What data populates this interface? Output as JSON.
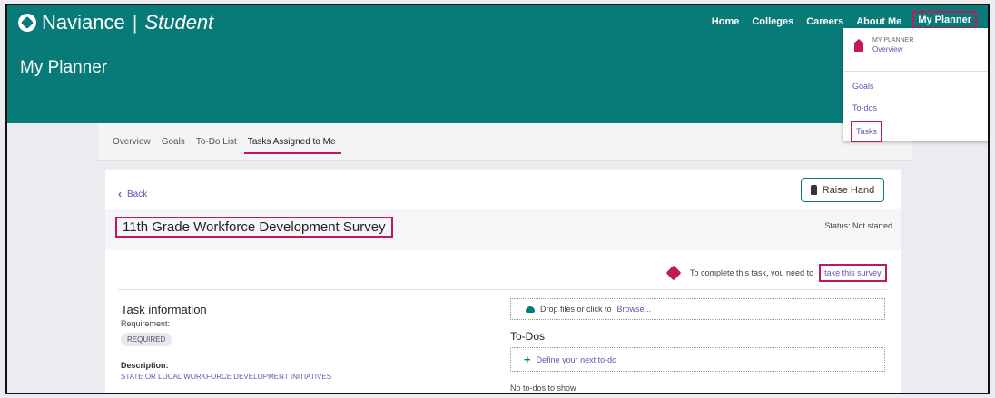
{
  "app": {
    "name": "Naviance",
    "separator": "|",
    "sub": "Student"
  },
  "page_title": "My Planner",
  "nav": {
    "home": "Home",
    "colleges": "Colleges",
    "careers": "Careers",
    "about": "About Me",
    "planner": "My Planner"
  },
  "dropdown": {
    "title": "MY PLANNER",
    "overview": "Overview",
    "goals": "Goals",
    "todos": "To-dos",
    "tasks": "Tasks"
  },
  "tabs": {
    "overview": "Overview",
    "goals": "Goals",
    "todo_list": "To-Do List",
    "assigned": "Tasks Assigned to Me"
  },
  "card": {
    "back": "Back",
    "raise_hand": "Raise Hand",
    "survey_title": "11th Grade Workforce Development Survey",
    "status": "Status: Not started",
    "complete_text": "To complete this task, you need to",
    "survey_link": "take this survey",
    "task_info_title": "Task information",
    "requirement_label": "Requirement:",
    "requirement_value": "REQUIRED",
    "description_label": "Description:",
    "description_value": "STATE OR LOCAL WORKFORCE DEVELOPMENT INITIATIVES",
    "drop_text": "Drop files or click to",
    "browse": "Browse...",
    "todos_title": "To-Dos",
    "define_todo": "Define your next to-do",
    "no_todos": "No to-dos to show"
  },
  "colors": {
    "teal": "#087b78",
    "accent": "#c2185b",
    "link": "#6a4fb6"
  },
  "icons": [
    "logo-icon",
    "house-icon",
    "chevron-left-icon",
    "hand-icon",
    "diamond-icon",
    "cloud-upload-icon",
    "plus-icon"
  ]
}
